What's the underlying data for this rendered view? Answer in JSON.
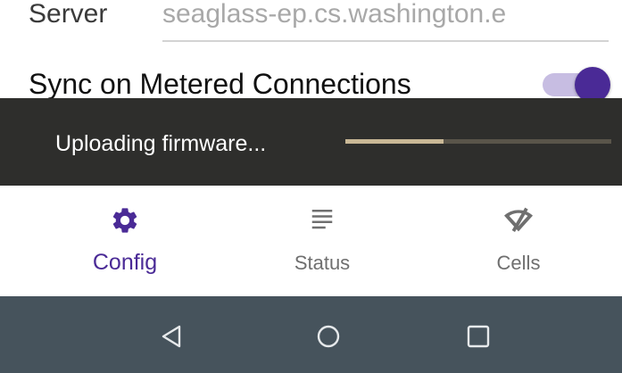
{
  "settings": {
    "server_label": "Server",
    "server_value": "seaglass-ep.cs.washington.e",
    "sync_label": "Sync on Metered Connections",
    "sync_enabled": true
  },
  "snackbar": {
    "message": "Uploading firmware...",
    "progress_fraction": 0.37
  },
  "bottom_nav": {
    "items": [
      {
        "label": "Config",
        "icon": "gear-icon",
        "active": true
      },
      {
        "label": "Status",
        "icon": "list-icon",
        "active": false
      },
      {
        "label": "Cells",
        "icon": "signal-off-icon",
        "active": false
      }
    ]
  },
  "system_nav": {
    "buttons": [
      "back-icon",
      "home-icon",
      "recents-icon"
    ]
  },
  "colors": {
    "accent": "#4a2a96",
    "toggle_track": "#c7bde2",
    "snackbar_bg": "#2e2e2c",
    "progress_fill": "#c9b896",
    "progress_track": "#5a554a",
    "system_nav_bg": "#46535c",
    "inactive_nav": "#6f6f6f"
  }
}
